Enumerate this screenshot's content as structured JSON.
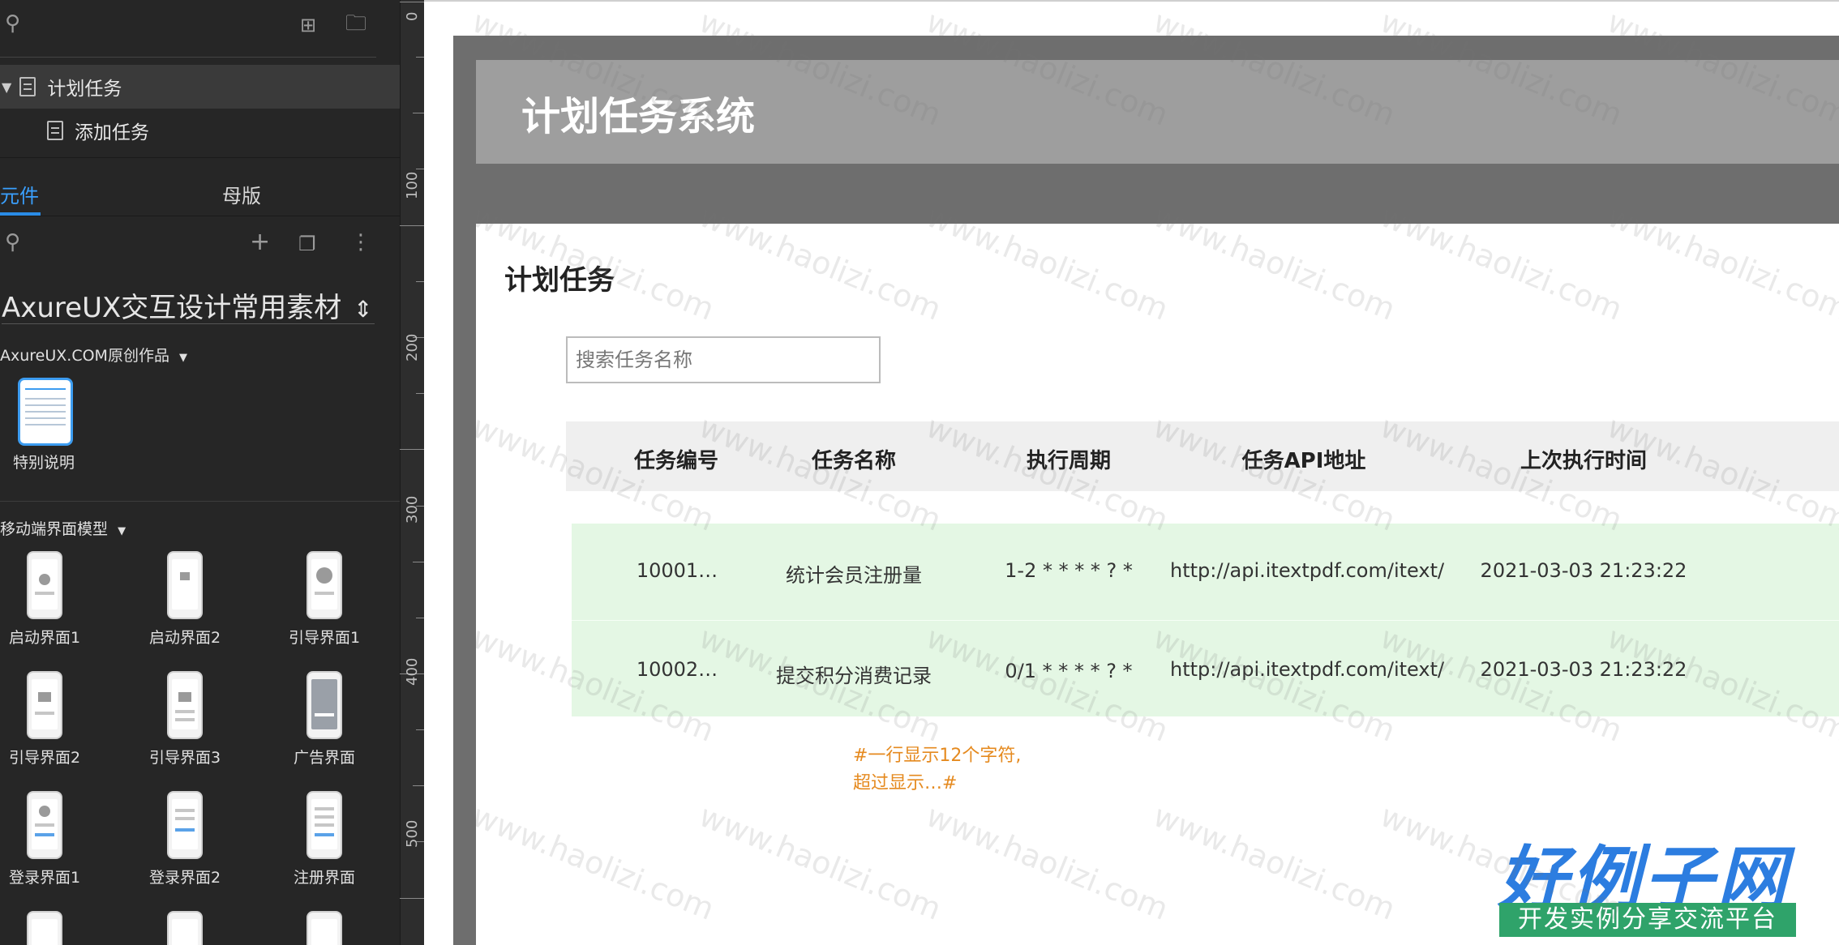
{
  "pages_panel": {
    "pages": [
      {
        "label": "计划任务",
        "selected": true,
        "expanded": true
      },
      {
        "label": "添加任务",
        "selected": false
      }
    ]
  },
  "library_panel": {
    "tabs": [
      {
        "label": "元件",
        "active": true
      },
      {
        "label": "母版",
        "active": false
      }
    ],
    "library_name": "AxureUX交互设计常用素材",
    "sections": [
      {
        "title": "AxureUX.COM原创作品",
        "items": [
          {
            "label": "特别说明"
          }
        ]
      },
      {
        "title": "移动端界面模型",
        "items": [
          {
            "label": "启动界面1"
          },
          {
            "label": "启动界面2"
          },
          {
            "label": "引导界面1"
          },
          {
            "label": "引导界面2"
          },
          {
            "label": "引导界面3"
          },
          {
            "label": "广告界面"
          },
          {
            "label": "登录界面1"
          },
          {
            "label": "登录界面2"
          },
          {
            "label": "注册界面"
          }
        ]
      }
    ]
  },
  "ruler": {
    "labels": [
      "0",
      "100",
      "200",
      "300",
      "400",
      "500"
    ]
  },
  "canvas": {
    "header_title": "计划任务系统",
    "page_title": "计划任务",
    "search_placeholder": "搜索任务名称",
    "table": {
      "columns": [
        "任务编号",
        "任务名称",
        "执行周期",
        "任务API地址",
        "上次执行时间"
      ],
      "rows": [
        [
          "10001…",
          "统计会员注册量",
          "1-2 * * * * ? *",
          "http://api.itextpdf.com/itext/",
          "2021-03-03 21:23:22"
        ],
        [
          "10002…",
          "提交积分消费记录",
          "0/1 * * * * ? *",
          "http://api.itextpdf.com/itext/",
          "2021-03-03 21:23:22"
        ]
      ]
    },
    "note_line1": "#一行显示12个字符,",
    "note_line2": "超过显示…#"
  },
  "brand": {
    "title": "好例子网",
    "subtitle": "开发实例分享交流平台"
  },
  "watermark_text": "www.haolizi.com",
  "colors": {
    "accent_blue": "#2a8ce6",
    "row_green": "#e4f7e4",
    "note_orange": "#e58a1f",
    "brand_blue": "#2c7de0",
    "brand_green": "#2fa36a"
  }
}
